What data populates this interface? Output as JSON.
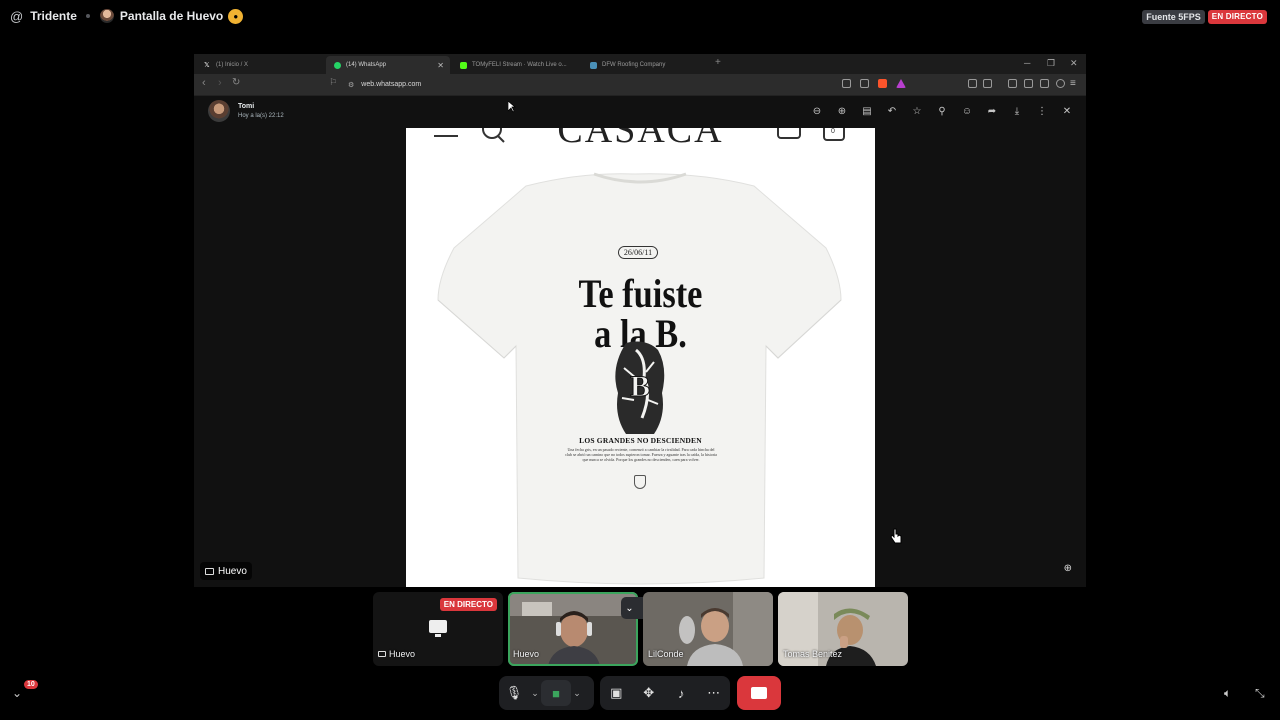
{
  "discord": {
    "server_name": "Tridente",
    "stream_title": "Pantalla de Huevo",
    "source_label": "Fuente 5FPS",
    "live_label": "EN DIRECTO"
  },
  "browser": {
    "tabs": [
      {
        "label": "(1) Inicio / X",
        "active": false,
        "icon_color": "#ffffff"
      },
      {
        "label": "(14) WhatsApp",
        "active": true,
        "icon_color": "#25d366"
      },
      {
        "label": "TOMyFELI Stream · Watch Live o...",
        "active": false,
        "icon_color": "#53fc18"
      },
      {
        "label": "DFW Roofing Company",
        "active": false,
        "icon_color": "#4a90b8"
      }
    ],
    "url": "web.whatsapp.com"
  },
  "media_viewer": {
    "sender_name": "Tomi",
    "sent_time": "Hoy a la(s) 22:12",
    "tools": [
      "zoom-out-icon",
      "zoom-in-icon",
      "caption-icon",
      "reply-icon",
      "star-icon",
      "pin-icon",
      "react-icon",
      "forward-icon",
      "download-icon",
      "more-icon",
      "close-icon"
    ]
  },
  "photo": {
    "brand": "CASACA",
    "cart_count": "0",
    "date_badge": "26/06/11",
    "headline_line1": "Te fuiste",
    "headline_line2": "a la B.",
    "slogan": "LOS GRANDES NO DESCIENDEN",
    "small_print": "Una fecha gris, en un pasado reciente, comenzó a cambiar la rivalidad. Para cada hincha del club se abrió un camino que no todos supieron tomar. Fuerza y aguante tras la caída, la historia que nunca se olvida. Porque los grandes no descienden, caen para volver."
  },
  "stream": {
    "name_tag": "Huevo"
  },
  "participants": [
    {
      "name": "Huevo",
      "type": "screen",
      "live_badge": "EN DIRECTO"
    },
    {
      "name": "Huevo",
      "type": "camera",
      "speaking": true
    },
    {
      "name": "LilConde",
      "type": "camera",
      "speaking": false
    },
    {
      "name": "Tomas Benitez",
      "type": "camera",
      "speaking": false
    }
  ],
  "bottom": {
    "notification_count": "10"
  },
  "colors": {
    "live_red": "#da373c",
    "speaking_green": "#3ba55d",
    "discord_dark": "#1e1f22"
  }
}
